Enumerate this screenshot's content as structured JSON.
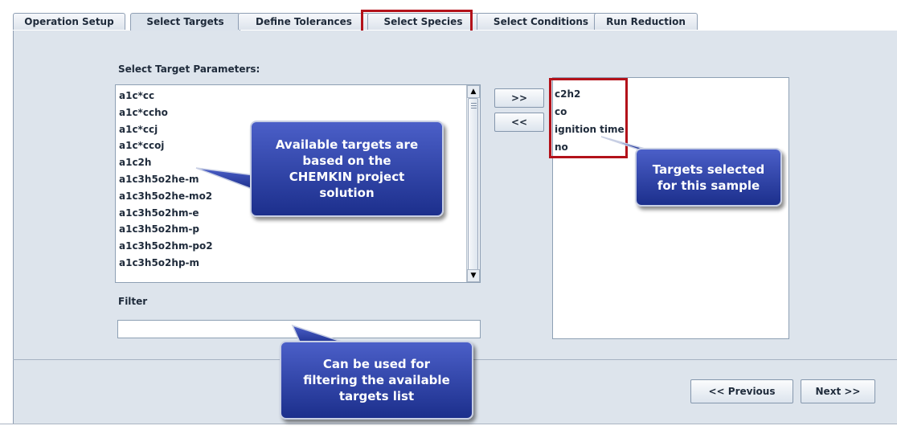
{
  "tabs": [
    {
      "label": "Operation Setup"
    },
    {
      "label": "Select Targets"
    },
    {
      "label": "Define Tolerances"
    },
    {
      "label": "Select Species"
    },
    {
      "label": "Select Conditions"
    },
    {
      "label": "Run Reduction"
    }
  ],
  "select_label": "Select Target Parameters:",
  "available_targets": [
    "a1c*cc",
    "a1c*ccho",
    "a1c*ccj",
    "a1c*ccoj",
    "a1c2h",
    "a1c3h5o2he-m",
    "a1c3h5o2he-mo2",
    "a1c3h5o2hm-e",
    "a1c3h5o2hm-p",
    "a1c3h5o2hm-po2",
    "a1c3h5o2hp-m"
  ],
  "selected_targets": [
    "c2h2",
    "co",
    "ignition time",
    "no"
  ],
  "add_button": ">>",
  "remove_button": "<<",
  "filter_label": "Filter",
  "filter_value": "",
  "callouts": {
    "available": [
      "Available targets are",
      "based on the",
      "CHEMKIN project",
      "solution"
    ],
    "selected": [
      "Targets selected",
      "for this sample"
    ],
    "filter": [
      "Can be used for",
      "filtering the available",
      "targets list"
    ]
  },
  "nav": {
    "previous": "<< Previous",
    "next": "Next >>"
  }
}
